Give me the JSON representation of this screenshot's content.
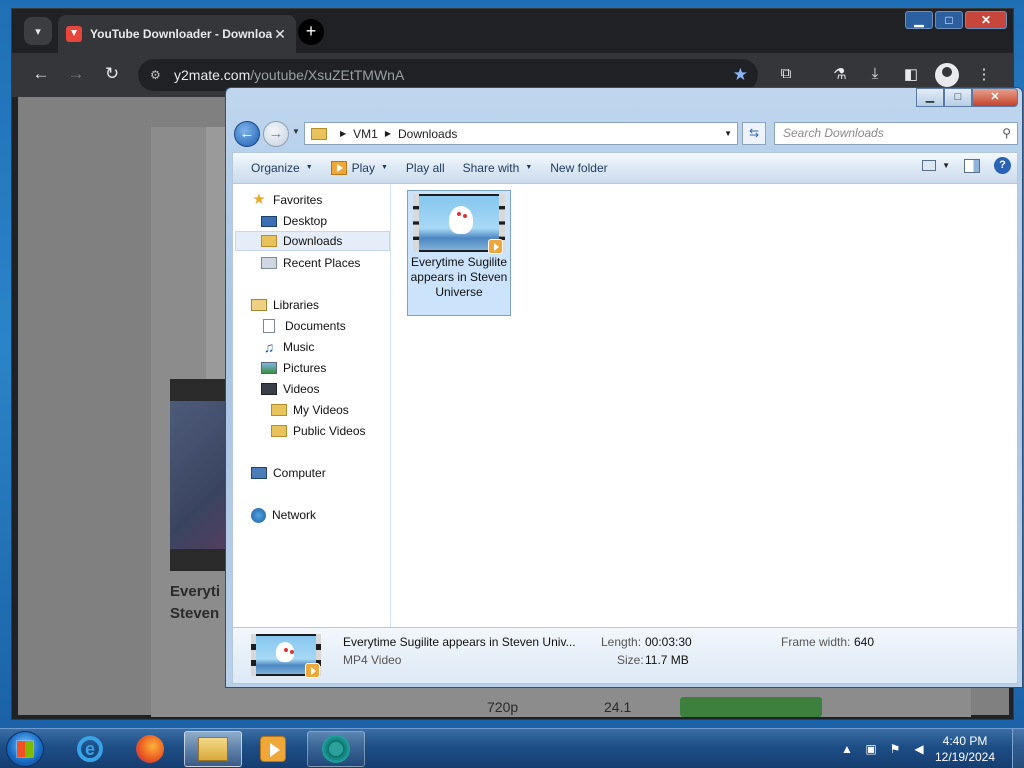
{
  "browser": {
    "tab_title": "YouTube Downloader - Download",
    "tab_close": "✕",
    "new_tab": "+",
    "url_host": "y2mate.com",
    "url_path": "/youtube/XsuZEtTMWnA",
    "window_controls": {
      "minimize": "▁",
      "maximize": "□",
      "close": "✕"
    }
  },
  "webpage": {
    "video_title_line1": "Everyti",
    "video_title_line2": "Steven",
    "row_quality": "720p",
    "row_size": "24.1"
  },
  "explorer": {
    "window_controls": {
      "minimize": "▁",
      "maximize": "□",
      "close": "✕"
    },
    "breadcrumb": [
      "VM1",
      "Downloads"
    ],
    "search_placeholder": "Search Downloads",
    "toolbar": {
      "organize": "Organize",
      "play": "Play",
      "play_all": "Play all",
      "share_with": "Share with",
      "new_folder": "New folder",
      "help": "?"
    },
    "nav": {
      "favorites": "Favorites",
      "desktop": "Desktop",
      "downloads": "Downloads",
      "recent_places": "Recent Places",
      "libraries": "Libraries",
      "documents": "Documents",
      "music": "Music",
      "pictures": "Pictures",
      "videos": "Videos",
      "my_videos": "My Videos",
      "public_videos": "Public Videos",
      "computer": "Computer",
      "network": "Network"
    },
    "files": [
      {
        "name": "Everytime Sugilite appears in Steven Universe"
      }
    ],
    "details": {
      "name": "Everytime Sugilite appears in Steven Univ...",
      "type": "MP4 Video",
      "length_label": "Length:",
      "length_value": "00:03:30",
      "size_label": "Size:",
      "size_value": "11.7 MB",
      "frame_width_label": "Frame width:",
      "frame_width_value": "640"
    }
  },
  "taskbar": {
    "time": "4:40 PM",
    "date": "12/19/2024",
    "apps": [
      "internet-explorer",
      "firefox",
      "windows-explorer",
      "windows-media-player",
      "chrome"
    ]
  }
}
